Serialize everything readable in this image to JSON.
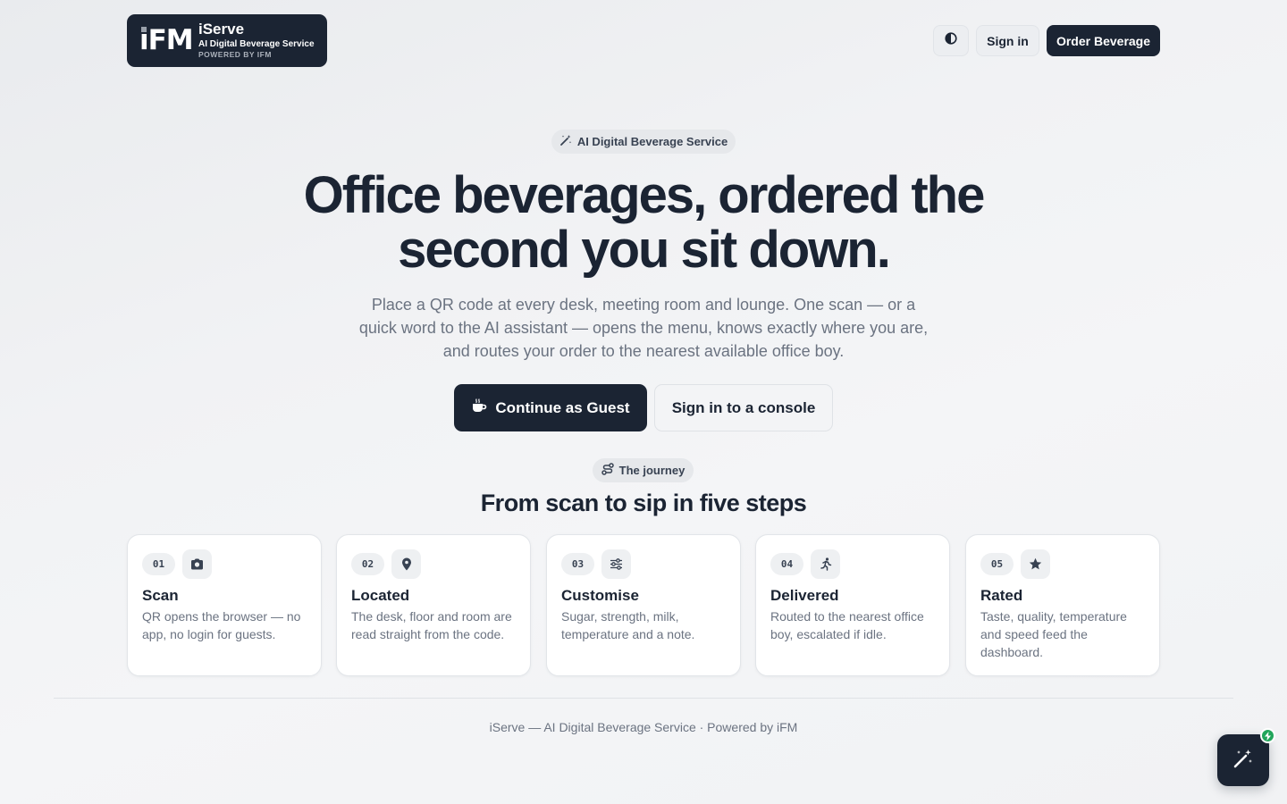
{
  "header": {
    "logo": {
      "mark": "iFM",
      "title": "iServe",
      "subtitle": "AI Digital Beverage Service",
      "powered": "POWERED BY IFM"
    },
    "theme_icon": "contrast-icon",
    "signin_label": "Sign in",
    "order_label": "Order Beverage"
  },
  "hero": {
    "pill_icon": "magic-wand-icon",
    "pill_label": "AI Digital Beverage Service",
    "title_line1": "Office beverages, ordered the",
    "title_line2": "second you sit down.",
    "subtitle": "Place a QR code at every desk, meeting room and lounge. One scan — or a quick word to the AI assistant — opens the menu, knows exactly where you are, and routes your order to the nearest available office boy.",
    "guest_icon": "coffee-cup-icon",
    "guest_label": "Continue as Guest",
    "console_label": "Sign in to a console"
  },
  "journey": {
    "pill_icon": "route-icon",
    "pill_label": "The journey",
    "title": "From scan to sip in five steps",
    "steps": [
      {
        "num": "01",
        "icon": "camera-icon",
        "title": "Scan",
        "desc": "QR opens the browser — no app, no login for guests."
      },
      {
        "num": "02",
        "icon": "map-pin-icon",
        "title": "Located",
        "desc": "The desk, floor and room are read straight from the code."
      },
      {
        "num": "03",
        "icon": "sliders-icon",
        "title": "Customise",
        "desc": "Sugar, strength, milk, temperature and a note."
      },
      {
        "num": "04",
        "icon": "running-person-icon",
        "title": "Delivered",
        "desc": "Routed to the nearest office boy, escalated if idle."
      },
      {
        "num": "05",
        "icon": "star-icon",
        "title": "Rated",
        "desc": "Taste, quality, temperature and speed feed the dashboard."
      }
    ]
  },
  "footer": {
    "text": "iServe — AI Digital Beverage Service · Powered by iFM"
  },
  "assistant": {
    "icon": "magic-wand-icon",
    "badge_icon": "lightning-icon"
  },
  "colors": {
    "primary": "#1b2433",
    "muted_text": "#6b7381",
    "badge_green": "#22a55b"
  }
}
